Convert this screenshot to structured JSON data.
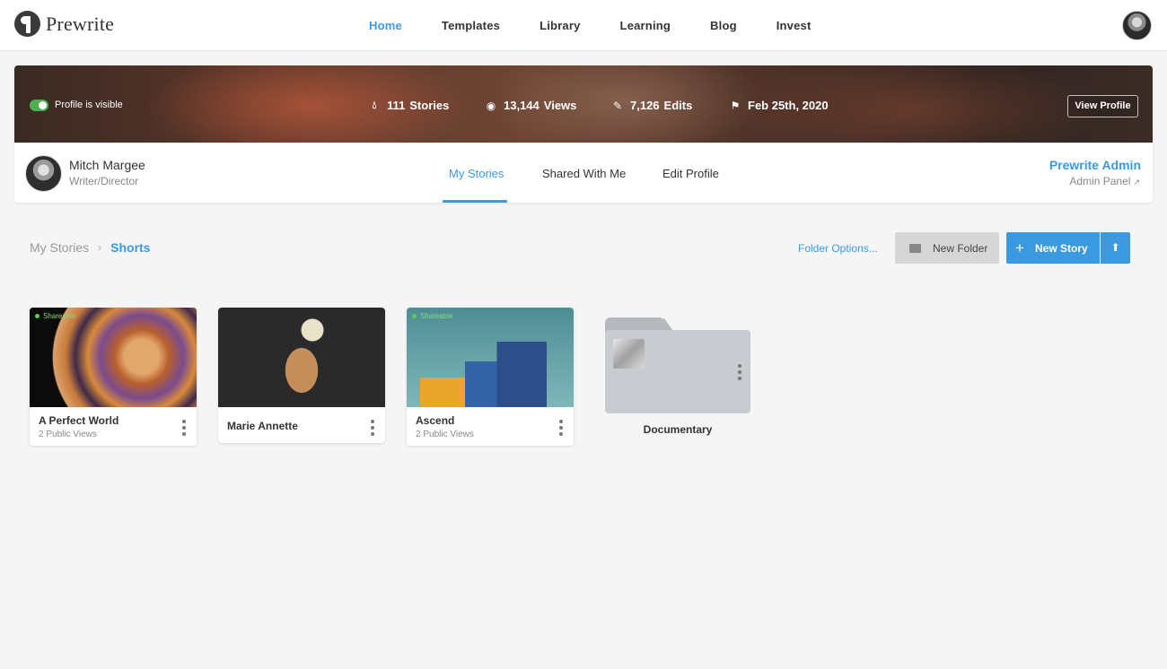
{
  "brand": {
    "name": "Prewrite"
  },
  "nav": {
    "items": [
      {
        "label": "Home",
        "active": true
      },
      {
        "label": "Templates"
      },
      {
        "label": "Library"
      },
      {
        "label": "Learning"
      },
      {
        "label": "Blog"
      },
      {
        "label": "Invest"
      }
    ]
  },
  "profile": {
    "visibility_label": "Profile is visible",
    "visible": true,
    "stats": {
      "stories": {
        "value": "111",
        "label": "Stories",
        "icon": "drop-icon"
      },
      "views": {
        "value": "13,144",
        "label": "Views",
        "icon": "eye-icon"
      },
      "edits": {
        "value": "7,126",
        "label": "Edits",
        "icon": "pencil-icon"
      },
      "joined": {
        "value": "Feb 25th, 2020",
        "icon": "flag-icon"
      }
    },
    "view_profile_label": "View Profile",
    "user": {
      "name": "Mitch Margee",
      "role": "Writer/Director"
    },
    "tabs": [
      {
        "label": "My Stories",
        "active": true
      },
      {
        "label": "Shared With Me"
      },
      {
        "label": "Edit Profile"
      }
    ],
    "admin": {
      "title": "Prewrite Admin",
      "panel_label": "Admin Panel"
    }
  },
  "breadcrumb": {
    "root": "My Stories",
    "current": "Shorts"
  },
  "toolbar": {
    "folder_options_label": "Folder Options...",
    "new_folder_label": "New Folder",
    "new_story_label": "New Story"
  },
  "stories": [
    {
      "title": "A Perfect World",
      "subtitle": "2 Public Views",
      "badge": "Shareable"
    },
    {
      "title": "Marie Annette"
    },
    {
      "title": "Ascend",
      "subtitle": "2 Public Views",
      "badge": "Shareable"
    }
  ],
  "folders": [
    {
      "label": "Documentary"
    }
  ],
  "colors": {
    "accent": "#3b99e0",
    "toggle_on": "#4caf50",
    "shareable": "#5cd04a"
  }
}
